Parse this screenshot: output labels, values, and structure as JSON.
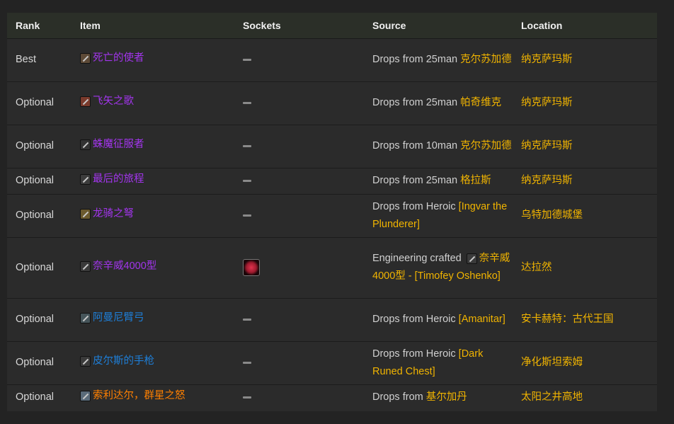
{
  "headers": {
    "rank": "Rank",
    "item": "Item",
    "sockets": "Sockets",
    "source": "Source",
    "location": "Location"
  },
  "rows": [
    {
      "rank": "Best",
      "item": "死亡的使者",
      "item_quality": "epic",
      "item_icon": "bow-icon",
      "icon_bg": "#5d4a37",
      "socket": "none",
      "source_prefix": "Drops from 25man ",
      "source_link": "克尔苏加德",
      "location": "纳克萨玛斯"
    },
    {
      "rank": "Optional",
      "item": "飞矢之歌",
      "item_quality": "epic",
      "item_icon": "bow-icon",
      "icon_bg": "#7a3a2c",
      "socket": "none",
      "source_prefix": "Drops from 25man ",
      "source_link": "帕奇维克",
      "location": "纳克萨玛斯"
    },
    {
      "rank": "Optional",
      "item": "蛛魔征服者",
      "item_quality": "epic",
      "item_icon": "gun-icon",
      "icon_bg": "#333333",
      "socket": "none",
      "source_prefix": "Drops from 10man ",
      "source_link": "克尔苏加德",
      "location": "纳克萨玛斯"
    },
    {
      "rank": "Optional",
      "item": "最后的旅程",
      "item_quality": "epic",
      "item_icon": "bow-icon",
      "icon_bg": "#3c3c3c",
      "socket": "none",
      "source_prefix": "Drops from 25man ",
      "source_link": "格拉斯",
      "location": "纳克萨玛斯"
    },
    {
      "rank": "Optional",
      "item": "龙骑之弩",
      "item_quality": "epic",
      "item_icon": "crossbow-icon",
      "icon_bg": "#6b5a2e",
      "socket": "none",
      "source_prefix": "Drops from Heroic ",
      "source_link": "[Ingvar the Plunderer]",
      "location": "乌特加德城堡"
    },
    {
      "rank": "Optional",
      "item": "奈辛威4000型",
      "item_quality": "epic",
      "item_icon": "gun-icon",
      "icon_bg": "#3a3a3a",
      "socket": "red",
      "source_prefix": "Engineering crafted ",
      "source_inline_icon": "gun-icon",
      "source_link": "奈辛威4000型 - [Timofey Oshenko]",
      "location": "达拉然"
    },
    {
      "rank": "Optional",
      "item": "阿曼尼臂弓",
      "item_quality": "rare",
      "item_icon": "crossbow-icon",
      "icon_bg": "#46555a",
      "socket": "none",
      "source_prefix": "Drops from Heroic ",
      "source_link": "[Amanitar]",
      "location": "安卡赫特：古代王国"
    },
    {
      "rank": "Optional",
      "item": "皮尔斯的手枪",
      "item_quality": "rare",
      "item_icon": "gun-icon",
      "icon_bg": "#3a3a3a",
      "socket": "none",
      "source_prefix": "Drops from Heroic ",
      "source_link": "[Dark Runed Chest]",
      "location": "净化斯坦索姆"
    },
    {
      "rank": "Optional",
      "item": "索利达尔，群星之怒",
      "item_quality": "legendary",
      "item_icon": "bow-icon",
      "icon_bg": "#5a6b7a",
      "socket": "none",
      "source_prefix": "Drops from ",
      "source_link": "基尔加丹",
      "location": "太阳之井高地"
    }
  ],
  "colors": {
    "page_bg": "#232323",
    "table_bg": "#2b2b2b",
    "header_bg": "#2b2f28",
    "epic": "#a335ee",
    "rare": "#1e7fd9",
    "legendary": "#ff8000",
    "link": "#f1b400"
  }
}
